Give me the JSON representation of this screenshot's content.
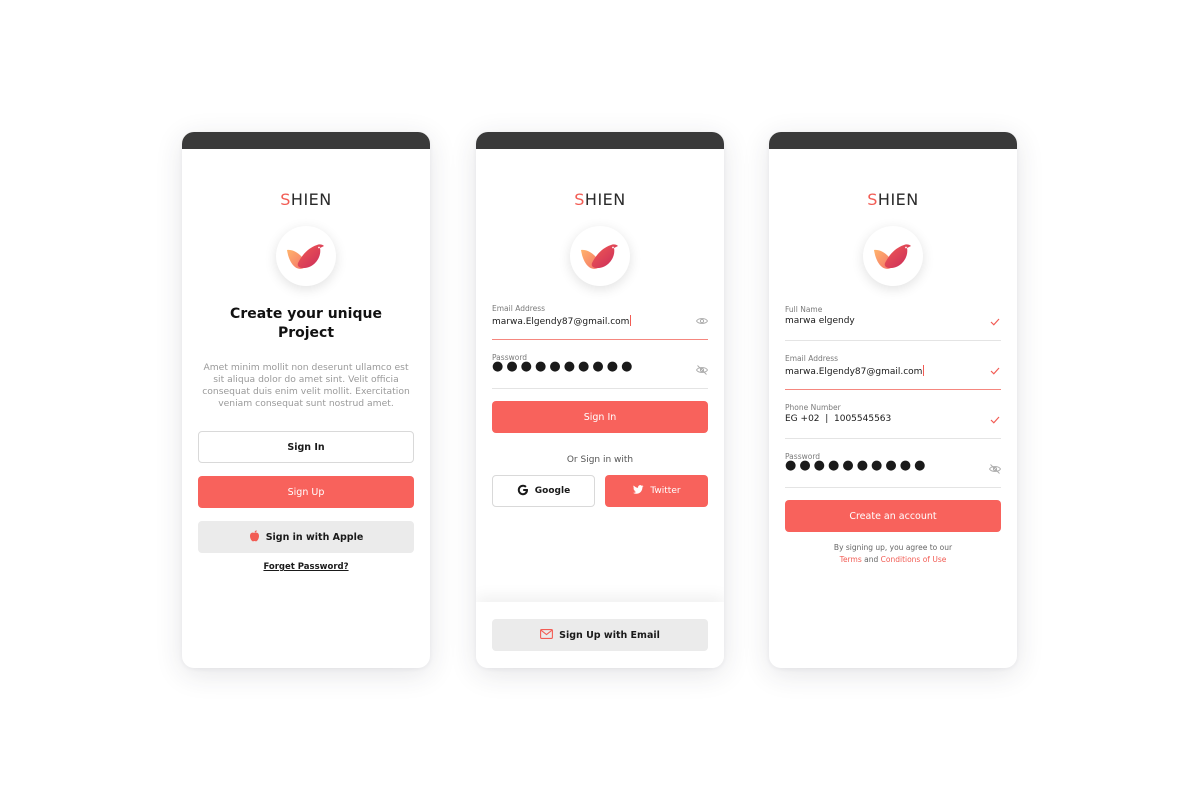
{
  "brand": {
    "first": "S",
    "rest": "HIEN",
    "accent": "#f25c54"
  },
  "screen1": {
    "title_line1": "Create your unique",
    "title_line2": "Project",
    "description": "Amet minim mollit non deserunt ullamco est sit aliqua dolor do amet sint. Velit officia consequat duis enim velit mollit. Exercitation veniam consequat sunt nostrud amet.",
    "sign_in_label": "Sign In",
    "sign_up_label": "Sign Up",
    "apple_label": "Sign in with Apple",
    "forgot_label": "Forget Password?"
  },
  "screen2": {
    "email_label": "Email Address",
    "email_value": "marwa.Elgendy87@gmail.com",
    "password_label": "Password",
    "password_value": "●●●●●●●●●●",
    "sign_in_label": "Sign In",
    "or_label": "Or Sign in with",
    "google_label": "Google",
    "twitter_label": "Twitter",
    "email_signup_label": "Sign Up with Email"
  },
  "screen3": {
    "name_label": "Full Name",
    "name_value": "marwa elgendy",
    "email_label": "Email Address",
    "email_value": "marwa.Elgendy87@gmail.com",
    "phone_label": "Phone Number",
    "phone_value": "EG +02  |  1005545563",
    "password_label": "Password",
    "password_value": "●●●●●●●●●●",
    "create_label": "Create an account",
    "terms_line1": "By signing up, you agree to our",
    "terms_link1": "Terms",
    "terms_and": "and",
    "terms_link2": "Conditions of Use"
  },
  "icons": [
    "bird-logo-icon",
    "apple-icon",
    "eye-icon",
    "eye-off-icon",
    "google-icon",
    "twitter-icon",
    "mail-icon",
    "check-icon"
  ],
  "colors": {
    "primary": "#f8625c",
    "statusbar": "#3a3a3a",
    "grey_button": "#ebebeb"
  }
}
